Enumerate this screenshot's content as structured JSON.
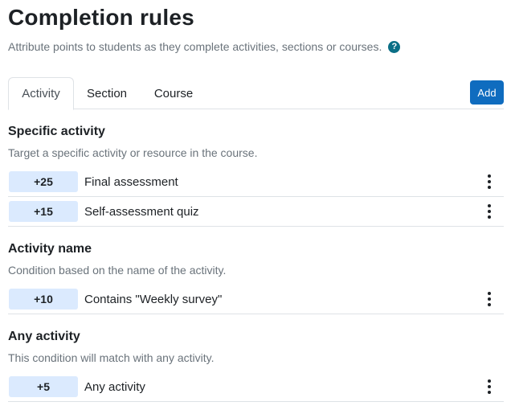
{
  "header": {
    "title": "Completion rules",
    "subtitle": "Attribute points to students as they complete activities, sections or courses.",
    "help_glyph": "?"
  },
  "tabs": [
    {
      "label": "Activity",
      "active": true
    },
    {
      "label": "Section",
      "active": false
    },
    {
      "label": "Course",
      "active": false
    }
  ],
  "add_label": "Add",
  "groups": [
    {
      "title": "Specific activity",
      "description": "Target a specific activity or resource in the course.",
      "rules": [
        {
          "points": "+25",
          "label": "Final assessment"
        },
        {
          "points": "+15",
          "label": "Self-assessment quiz"
        }
      ]
    },
    {
      "title": "Activity name",
      "description": "Condition based on the name of the activity.",
      "rules": [
        {
          "points": "+10",
          "label": "Contains \"Weekly survey\""
        }
      ]
    },
    {
      "title": "Any activity",
      "description": "This condition will match with any activity.",
      "rules": [
        {
          "points": "+5",
          "label": "Any activity"
        }
      ]
    }
  ],
  "colors": {
    "accent": "#0f6cbf",
    "help": "#0b6f86",
    "badge_bg": "#dbeafe",
    "muted_text": "#6a737b"
  },
  "icons": {
    "help": "question-circle-icon",
    "row_menu": "kebab-menu-icon"
  }
}
